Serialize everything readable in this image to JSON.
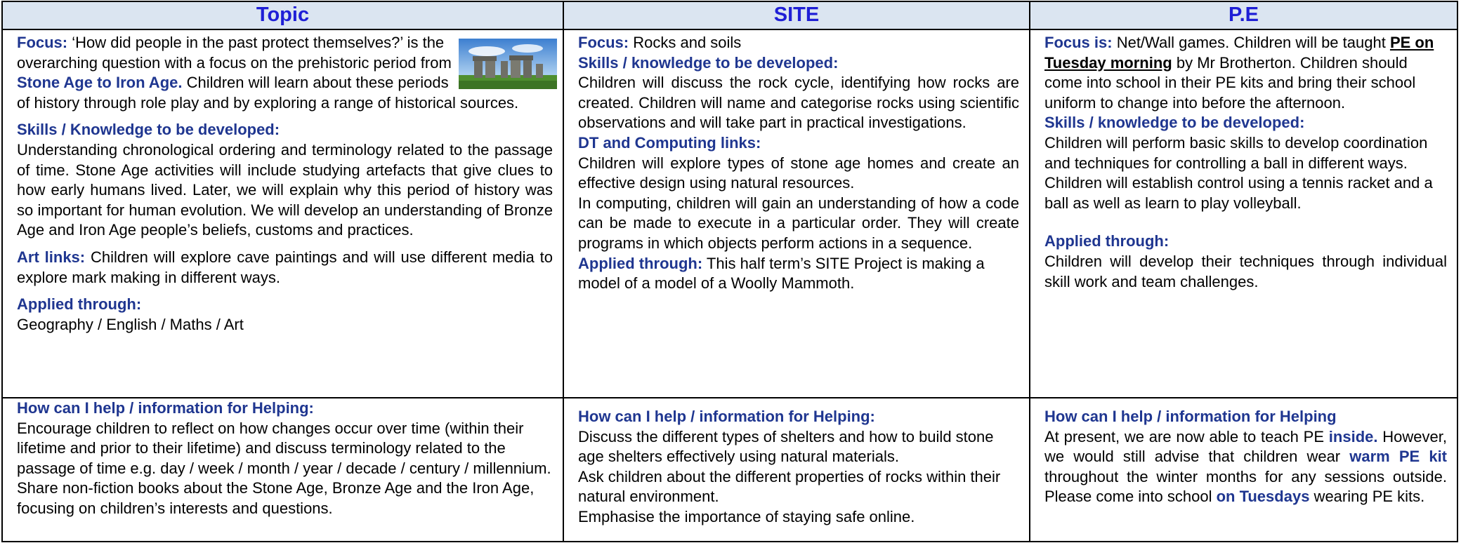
{
  "headers": {
    "topic": "Topic",
    "site": "SITE",
    "pe": "P.E"
  },
  "topic": {
    "focus_label": "Focus:",
    "focus_text1": " ‘How did people in the past protect themselves?’ is the overarching question with a focus on the prehistoric period from ",
    "focus_bold": "Stone Age to Iron Age.",
    "focus_text2": " Children will learn about these periods of history through role play and by exploring a range of historical sources.",
    "skills_label": "Skills / Knowledge to be developed:",
    "skills_text": "Understanding chronological ordering and terminology related to the passage of time.  Stone Age activities will include studying artefacts that give clues to how early humans lived. Later, we will explain why this period of history was so important for human evolution. We will develop an understanding of Bronze Age and Iron Age people’s beliefs, customs and practices.",
    "art_label": "Art links:",
    "art_text": " Children will explore cave paintings and will use different media to explore mark making in different ways.",
    "applied_label": "Applied through:",
    "applied_text": "Geography / English / Maths / Art",
    "image_icon": "stonehenge-photo"
  },
  "site": {
    "focus_label": "Focus:",
    "focus_text": " Rocks and soils",
    "skills_label": "Skills / knowledge to be developed:",
    "skills_text": "Children will discuss the rock cycle, identifying how rocks are created. Children will name and categorise rocks using scientific observations and will take part in practical investigations.",
    "dt_label": "DT and Computing links:",
    "dt_text1": "Children will explore types of stone age homes and create an effective design using natural resources.",
    "dt_text2": "In computing, children will gain an understanding of how a code can be made to execute in a particular order. They will create programs in which objects perform actions in a sequence.",
    "applied_label": "Applied through:",
    "applied_text": " This half term’s SITE Project is making a model of a model of a Woolly Mammoth."
  },
  "pe": {
    "focus_label": "Focus is:",
    "focus_text1": " Net/Wall games. Children will be taught ",
    "focus_underline": "PE on Tuesday morning",
    "focus_text2": " by Mr Brotherton. Children should come into school in their PE kits and bring their school uniform to change into before the afternoon.",
    "skills_label": "Skills / knowledge to be developed:",
    "skills_text": "Children will perform basic skills to develop coordination and techniques for controlling a ball in different ways. Children will establish control using a tennis racket and a ball as well as learn to play volleyball.",
    "applied_label": "Applied through:",
    "applied_text": "Children will develop their techniques through individual skill work and team challenges."
  },
  "help_topic": {
    "label": "How can I help / information for Helping:",
    "text1": "Encourage children to reflect on how changes occur over time (within their lifetime and prior to their lifetime) and discuss terminology related to the passage of time e.g. day / week / month / year / decade / century / millennium.",
    "text2": "Share non-fiction books about the Stone Age, Bronze Age and the Iron Age, focusing on children’s interests and questions."
  },
  "help_site": {
    "label": "How can I help / information for Helping:",
    "text1": "Discuss the different types of shelters and how to build stone age shelters effectively using natural materials.",
    "text2": "Ask children about the different properties of rocks within their natural environment.",
    "text3": "Emphasise the importance of staying safe online."
  },
  "help_pe": {
    "label": "How can I help / information for Helping",
    "t1": "At present, we are now able to teach PE ",
    "b1": "inside.",
    "t2": " However, we would still advise that children wear ",
    "b2": "warm PE kit",
    "t3": " throughout the winter months for any sessions outside. Please come into school ",
    "b3": "on Tuesdays",
    "t4": " wearing PE kits."
  }
}
